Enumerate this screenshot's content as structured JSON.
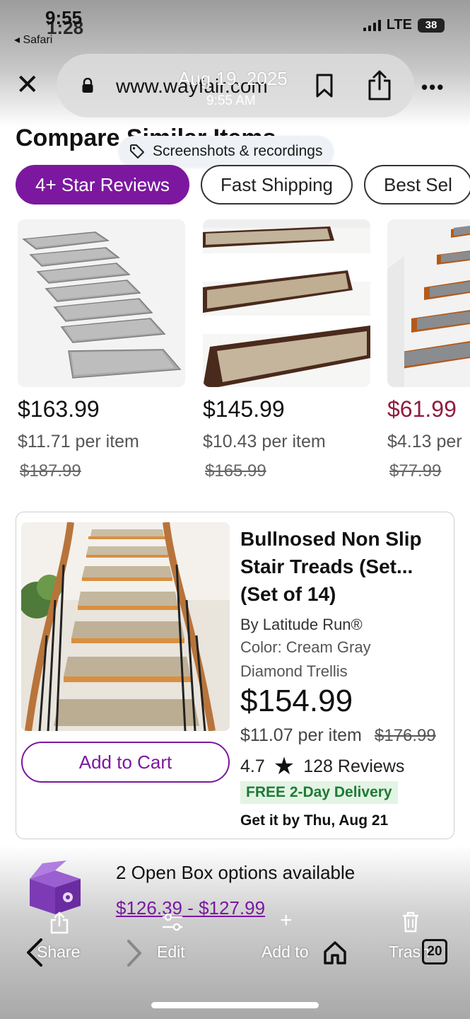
{
  "status_bar": {
    "time_primary": "9:55",
    "time_secondary": "1:28",
    "back_app": "◂ Safari",
    "network": "LTE",
    "battery": "38"
  },
  "browser": {
    "url": "www.wayfair.com",
    "overlay_date": "Aug 19, 2025",
    "overlay_time": "9:55 AM",
    "icons": [
      "close-icon",
      "lock-icon",
      "bookmark-icon",
      "share-icon",
      "more-icon"
    ]
  },
  "page": {
    "section_title": "Compare Similar Items",
    "tooltip": "Screenshots & recordings",
    "filter_chips": [
      {
        "label": "4+ Star Reviews",
        "active": true
      },
      {
        "label": "Fast Shipping",
        "active": false
      },
      {
        "label": "Best Sel",
        "active": false
      }
    ],
    "products": [
      {
        "price": "$163.99",
        "per_item": "$11.71 per item",
        "was": "$187.99",
        "sale": false
      },
      {
        "price": "$145.99",
        "per_item": "$10.43 per item",
        "was": "$165.99",
        "sale": false
      },
      {
        "price": "$61.99",
        "per_item": "$4.13 per",
        "was": "$77.99",
        "sale": true
      }
    ],
    "featured": {
      "title_line1": "Bullnosed Non Slip",
      "title_line2": "Stair Treads (Set...",
      "title_line3": "(Set of 14)",
      "brand": "By Latitude Run®",
      "color_line1": "Color: Cream Gray",
      "color_line2": "Diamond Trellis",
      "price": "$154.99",
      "per_item": "$11.07 per item",
      "was": "$176.99",
      "rating": "4.7",
      "reviews": "128 Reviews",
      "delivery_badge": "FREE 2-Day Delivery",
      "delivery_date": "Get it by Thu, Aug 21",
      "add_to_cart": "Add to Cart"
    },
    "open_box": {
      "text": "2 Open Box options available",
      "range": "$126.39 - $127.99"
    }
  },
  "photos_toolbar": {
    "share": "Share",
    "edit": "Edit",
    "add_to": "Add to",
    "trash": "Trash",
    "count": "20"
  },
  "colors": {
    "brand_purple": "#7b189f",
    "sale_red": "#8f1d3f",
    "delivery_green": "#1f7a36"
  }
}
